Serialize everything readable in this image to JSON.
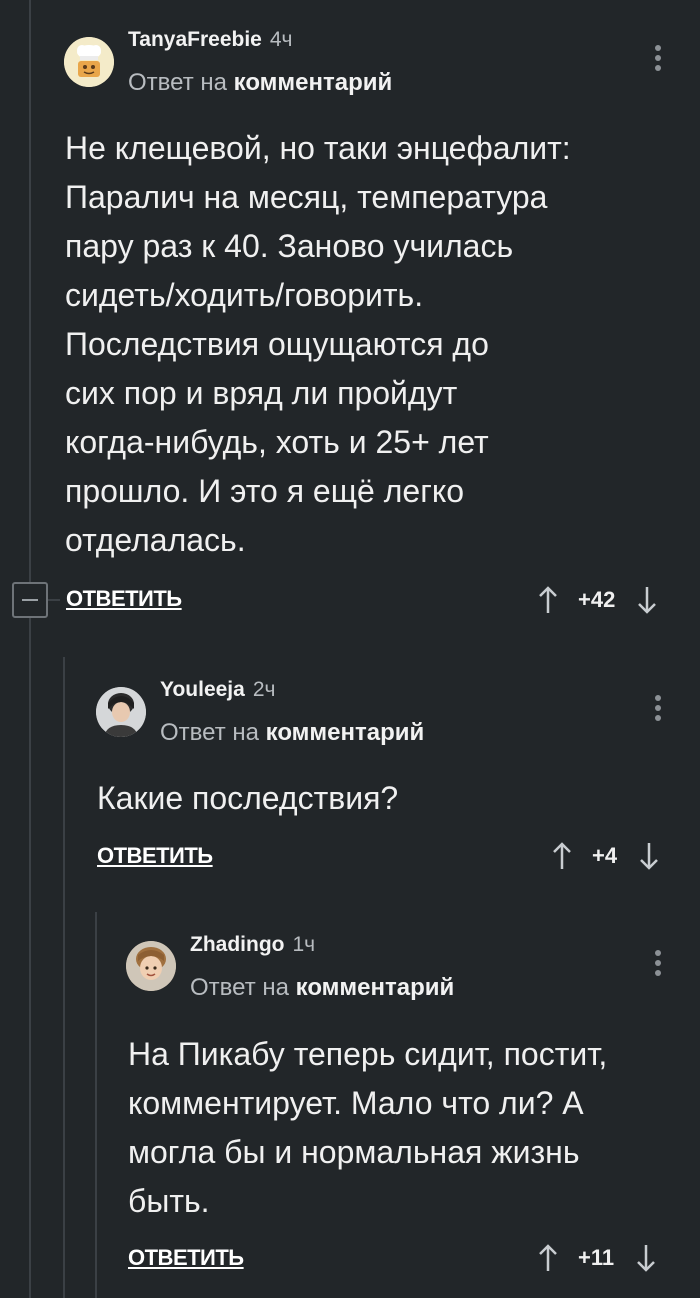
{
  "comments": [
    {
      "username": "TanyaFreebie",
      "time": "4ч",
      "reply_prefix": "Ответ на",
      "reply_target": "комментарий",
      "body_lines": [
        "Не клещевой, но таки энцефалит:",
        "Паралич на месяц, температура",
        "пару раз к 40. Заново училась",
        "сидеть/ходить/говорить.",
        "Последствия ощущаются до",
        "сих пор и вряд ли пройдут",
        "когда-нибудь, хоть и 25+ лет",
        "прошло. И это я ещё легко",
        "отделалась."
      ],
      "reply_label": "ОТВЕТИТЬ",
      "score": "+42"
    },
    {
      "username": "Youleeja",
      "time": "2ч",
      "reply_prefix": "Ответ на",
      "reply_target": "комментарий",
      "body_lines": [
        "Какие последствия?"
      ],
      "reply_label": "ОТВЕТИТЬ",
      "score": "+4"
    },
    {
      "username": "Zhadingo",
      "time": "1ч",
      "reply_prefix": "Ответ на",
      "reply_target": "комментарий",
      "body_lines": [
        "На Пикабу теперь сидит, постит,",
        "комментирует. Мало что ли? А",
        "могла бы и нормальная жизнь",
        "быть."
      ],
      "reply_label": "ОТВЕТИТЬ",
      "score": "+11"
    }
  ],
  "icons": {
    "collapse": "minus-square-icon",
    "upvote": "arrow-up-icon",
    "downvote": "arrow-down-icon",
    "more": "vertical-dots-icon"
  },
  "colors": {
    "background": "#222629",
    "text": "#f0f0f0",
    "muted": "#b8bcc0",
    "thread_line": "#3b4045"
  }
}
